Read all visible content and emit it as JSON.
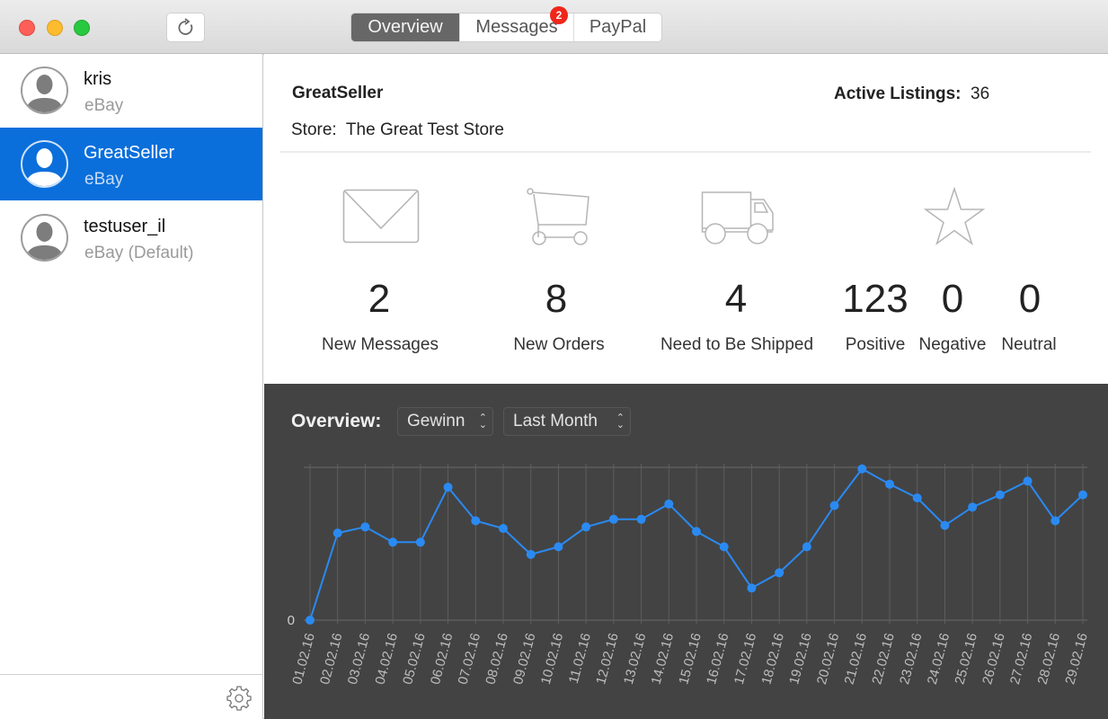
{
  "window": {
    "traffic_lights": [
      "close",
      "minimize",
      "zoom"
    ],
    "toolbar": {
      "sidebar_toggle_icon": "sidebar-icon",
      "reload_icon": "reload-icon"
    },
    "tabs": [
      {
        "label": "Overview",
        "active": true
      },
      {
        "label": "Messages",
        "badge": "2",
        "active": false
      },
      {
        "label": "PayPal",
        "active": false
      }
    ]
  },
  "sidebar": {
    "accounts": [
      {
        "name": "kris",
        "platform": "eBay",
        "selected": false
      },
      {
        "name": "GreatSeller",
        "platform": "eBay",
        "selected": true
      },
      {
        "name": "testuser_il",
        "platform": "eBay (Default)",
        "selected": false
      }
    ],
    "settings_icon": "gear-icon"
  },
  "header": {
    "seller": "GreatSeller",
    "active_listings_label": "Active Listings:",
    "active_listings_value": "36",
    "store_label": "Store:",
    "store_name": "The Great Test Store"
  },
  "stats": {
    "messages": {
      "icon": "envelope-icon",
      "value": "2",
      "label": "New Messages"
    },
    "orders": {
      "icon": "cart-icon",
      "value": "8",
      "label": "New Orders"
    },
    "shipping": {
      "icon": "truck-icon",
      "value": "4",
      "label": "Need to Be Shipped"
    },
    "feedback": {
      "icon": "star-icon",
      "positive": {
        "value": "123",
        "label": "Positive"
      },
      "negative": {
        "value": "0",
        "label": "Negative"
      },
      "neutral": {
        "value": "0",
        "label": "Neutral"
      }
    }
  },
  "overview": {
    "label": "Overview:",
    "metric_select": "Gewinn",
    "range_select": "Last Month"
  },
  "colors": {
    "accent": "#0a6fdb",
    "line": "#2a8af2",
    "badge": "#f0261b",
    "chart_bg": "#434343"
  },
  "chart_data": {
    "type": "line",
    "title": "",
    "xlabel": "",
    "ylabel": "",
    "y_tick_labels": [
      "0"
    ],
    "ylim": [
      0,
      100
    ],
    "ylim_note": "relative scale; top gridline = 100, only '0' labeled",
    "grid": true,
    "legend": "none",
    "x": [
      "01.02.16",
      "02.02.16",
      "03.02.16",
      "04.02.16",
      "05.02.16",
      "06.02.16",
      "07.02.16",
      "08.02.16",
      "09.02.16",
      "10.02.16",
      "11.02.16",
      "12.02.16",
      "13.02.16",
      "14.02.16",
      "15.02.16",
      "16.02.16",
      "17.02.16",
      "18.02.16",
      "19.02.16",
      "20.02.16",
      "21.02.16",
      "22.02.16",
      "23.02.16",
      "24.02.16",
      "25.02.16",
      "26.02.16",
      "27.02.16",
      "28.02.16",
      "29.02.16"
    ],
    "series": [
      {
        "name": "Gewinn",
        "values": [
          0,
          57,
          61,
          51,
          51,
          87,
          65,
          60,
          43,
          48,
          61,
          66,
          66,
          76,
          58,
          48,
          21,
          31,
          48,
          75,
          99,
          89,
          80,
          62,
          74,
          82,
          91,
          65,
          82
        ]
      }
    ]
  }
}
